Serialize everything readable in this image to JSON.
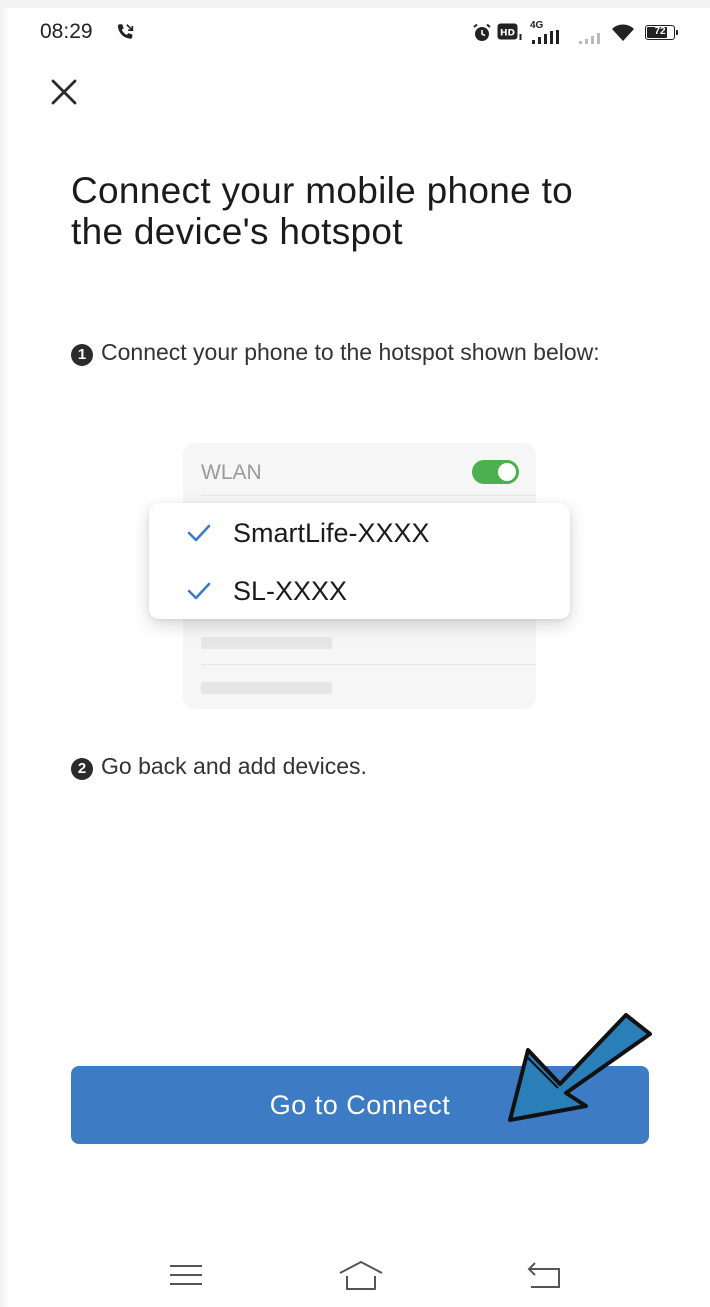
{
  "status_bar": {
    "time": "08:29",
    "network": "4G",
    "battery": "72",
    "battery_level": 0.72,
    "icons": [
      "call-icon",
      "alarm-icon",
      "hd-icon",
      "signal-icon",
      "wifi-icon",
      "battery-icon"
    ]
  },
  "header": {
    "close_icon": "close-icon"
  },
  "page": {
    "title": "Connect your mobile phone to the device's hotspot",
    "steps": [
      {
        "number": "1",
        "text": "Connect your phone to the hotspot shown below:"
      },
      {
        "number": "2",
        "text": "Go back and add devices."
      }
    ]
  },
  "illustration": {
    "wlan_label": "WLAN",
    "wlan_enabled": true,
    "hotspots": [
      {
        "name": "SmartLife-XXXX",
        "icon": "check-icon"
      },
      {
        "name": "SL-XXXX",
        "icon": "check-icon"
      }
    ],
    "colors": {
      "toggle_on": "#4caf50",
      "check": "#3d7cc5"
    }
  },
  "actions": {
    "primary_label": "Go to Connect",
    "primary_color": "#3d7cc5"
  },
  "annotation": {
    "icon": "arrow-pointer-icon",
    "color": "#2a7fb8"
  },
  "nav_bar": {
    "icons": [
      "menu-icon",
      "home-icon",
      "back-icon"
    ]
  }
}
